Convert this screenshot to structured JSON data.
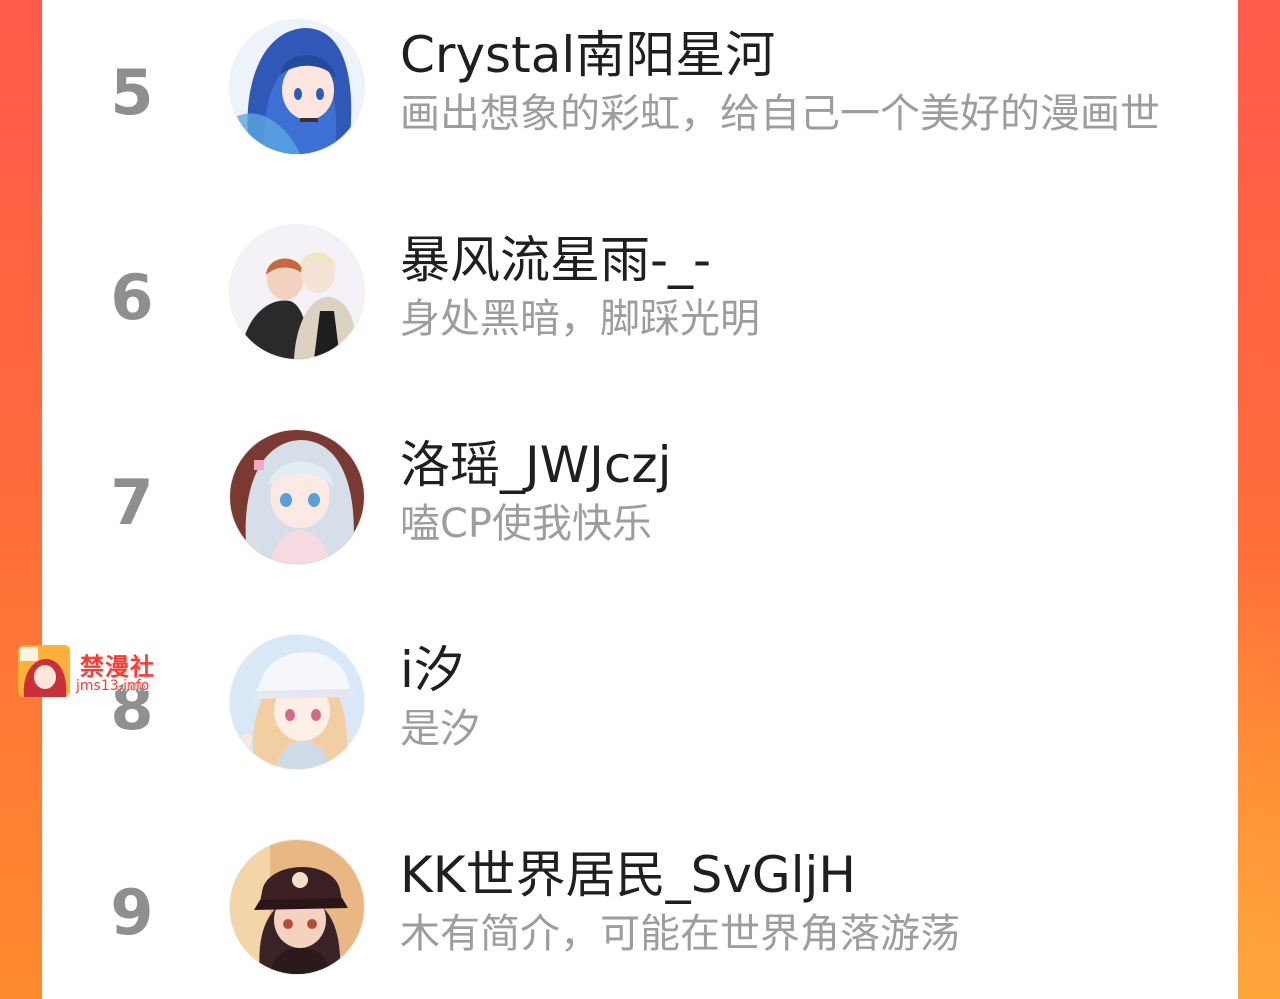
{
  "ranking": {
    "entries": [
      {
        "rank": "5",
        "name": "Crystal南阳星河",
        "bio": "画出想象的彩虹，给自己一个美好的漫画世",
        "avatar": "anime-girl-blue-hair-avatar"
      },
      {
        "rank": "6",
        "name": "暴风流星雨-_-",
        "bio": "身处黑暗，脚踩光明",
        "avatar": "anime-couple-avatar"
      },
      {
        "rank": "7",
        "name": "洛瑶_JWJczj",
        "bio": "嗑CP使我快乐",
        "avatar": "anime-girl-silver-hair-avatar"
      },
      {
        "rank": "8",
        "name": "i汐",
        "bio": "是汐",
        "avatar": "anime-girl-cap-avatar"
      },
      {
        "rank": "9",
        "name": "KK世界居民_SvGljH",
        "bio": "木有简介，可能在世界角落游荡",
        "avatar": "anime-boy-cap-avatar"
      }
    ]
  },
  "watermark": {
    "title": "禁漫社",
    "url": "jms13.info"
  },
  "colors": {
    "background_top": "#ff5a4a",
    "background_bottom": "#ff8a2e",
    "rank_number": "#8f8f8f",
    "name_text": "#1f1f1f",
    "bio_text": "#9d9d9d",
    "watermark": "#ff3b2f"
  }
}
